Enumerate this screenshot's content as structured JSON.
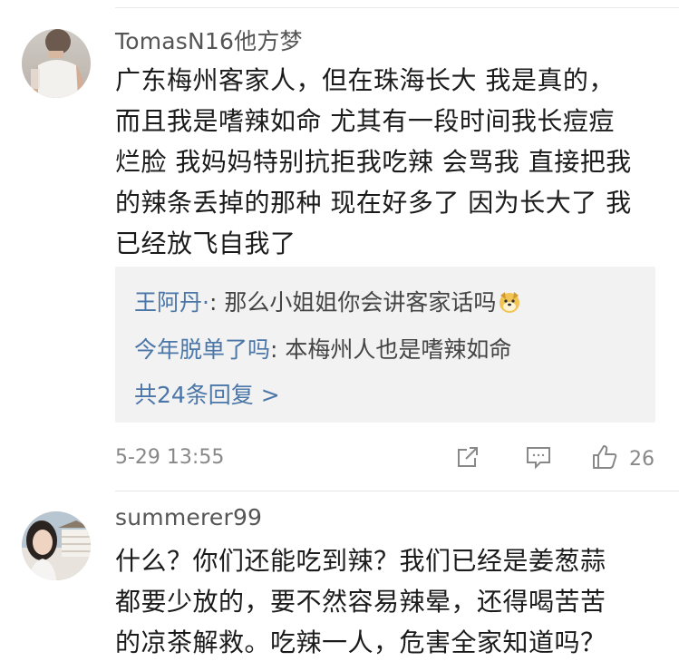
{
  "comments": [
    {
      "username": "TomasN16他方梦",
      "text": "广东梅州客家人，但在珠海长大 我是真的，\n而且我是嗜辣如命 尤其有一段时间我长痘痘\n烂脸 我妈妈特别抗拒我吃辣 会骂我 直接把我\n的辣条丢掉的那种 现在好多了 因为长大了 我\n已经放飞自我了",
      "replies": [
        {
          "name": "王阿丹·",
          "text": ": 那么小姐姐你会讲客家话吗",
          "emoji": "dog-face-emoji"
        },
        {
          "name": "今年脱单了吗",
          "text": ": 本梅州人也是嗜辣如命"
        }
      ],
      "more_replies": "共24条回复 >",
      "time": "5-29 13:55",
      "likes": "26"
    },
    {
      "username": "summerer99",
      "text": "什么？你们还能吃到辣？我们已经是姜葱蒜\n都要少放的，要不然容易辣晕，还得喝苦苦\n的凉茶解救。吃辣一人，危害全家知道吗？"
    }
  ],
  "colors": {
    "link": "#4a76a8",
    "meta": "#888888",
    "reply_bg": "#f2f2f2"
  },
  "icons": [
    "share-icon",
    "comment-icon",
    "thumbs-up-icon"
  ]
}
